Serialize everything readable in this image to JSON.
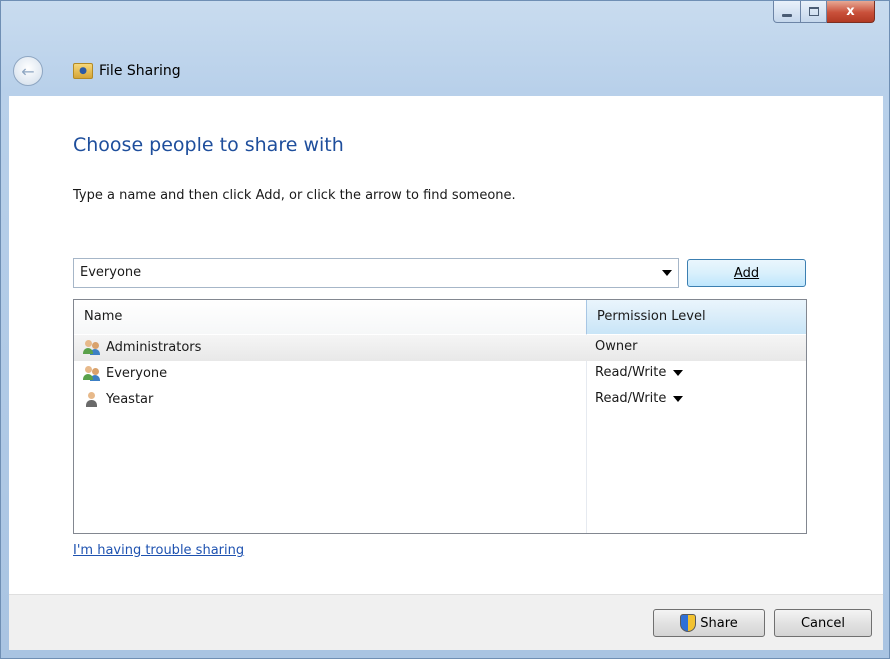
{
  "window": {
    "title": "File Sharing",
    "caption_buttons": {
      "minimize": "minimize",
      "maximize": "maximize",
      "close": "x"
    }
  },
  "content": {
    "heading": "Choose people to share with",
    "instructions": "Type a name and then click Add, or click the arrow to find someone.",
    "combo": {
      "value": "Everyone"
    },
    "add_button": "Add",
    "list": {
      "columns": [
        "Name",
        "Permission Level"
      ],
      "rows": [
        {
          "name": "Administrators",
          "permission": "Owner",
          "icon": "group-users-icon",
          "has_dropdown": false,
          "selected": true
        },
        {
          "name": "Everyone",
          "permission": "Read/Write",
          "icon": "group-users-icon",
          "has_dropdown": true,
          "selected": false
        },
        {
          "name": "Yeastar",
          "permission": "Read/Write",
          "icon": "user-icon",
          "has_dropdown": true,
          "selected": false
        }
      ]
    },
    "trouble_link": "I'm having trouble sharing"
  },
  "footer": {
    "share_button": "Share",
    "cancel_button": "Cancel"
  },
  "colors": {
    "heading": "#1e4e9c",
    "link": "#1e52b0",
    "close_button": "#c9503a",
    "frame": "#b8d0ea"
  }
}
